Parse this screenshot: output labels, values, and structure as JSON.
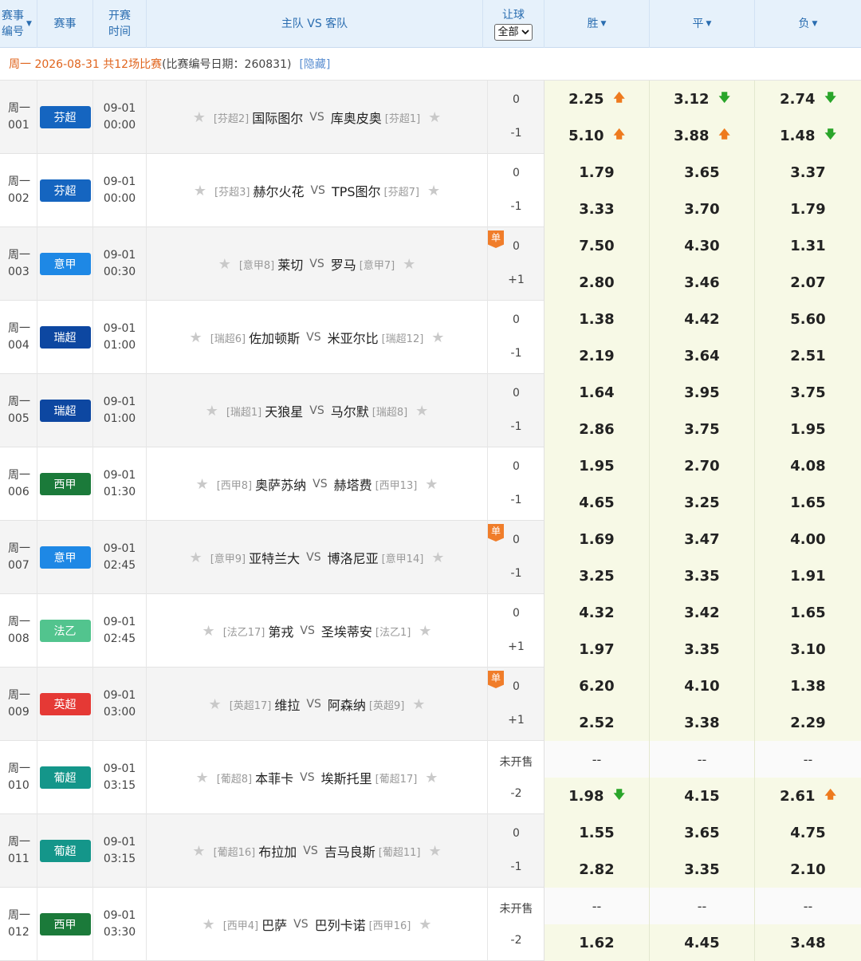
{
  "header": {
    "num_label_line1": "赛事",
    "num_label_line2": "编号",
    "league_label": "赛事",
    "time_label_line1": "开赛",
    "time_label_line2": "时间",
    "teams_label": "主队 VS 客队",
    "handicap_label": "让球",
    "handicap_select": "全部",
    "win_label": "胜",
    "draw_label": "平",
    "lose_label": "负"
  },
  "date_bar": {
    "summary": "周一 2026-08-31 共12场比赛",
    "detail": "(比赛编号日期：260831)",
    "hide_link": "[隐藏]"
  },
  "colors": {
    "finland": "#1565c0",
    "italy": "#1e88e5",
    "swiss": "#0d47a1",
    "spain": "#1b7a3a",
    "ligue2": "#52c48e",
    "epl": "#e53935",
    "portugal": "#14968a",
    "arrow_up": "#ee7a1e",
    "arrow_down": "#2aa52a",
    "dan_badge": "#f07d2a"
  },
  "matches": [
    {
      "day": "周一",
      "num": "001",
      "league": "芬超",
      "color": "#1565c0",
      "date": "09-01",
      "time": "00:00",
      "home_rank": "[芬超2]",
      "home": "国际图尔",
      "vs": "VS",
      "away": "库奥皮奥",
      "away_rank": "[芬超1]",
      "dan": "",
      "hc0": "0",
      "hc1": "-1",
      "odds": [
        [
          {
            "v": "2.25",
            "a": "up"
          },
          {
            "v": "3.12",
            "a": "down"
          },
          {
            "v": "2.74",
            "a": "down"
          }
        ],
        [
          {
            "v": "5.10",
            "a": "up"
          },
          {
            "v": "3.88",
            "a": "up"
          },
          {
            "v": "1.48",
            "a": "down"
          }
        ]
      ]
    },
    {
      "day": "周一",
      "num": "002",
      "league": "芬超",
      "color": "#1565c0",
      "date": "09-01",
      "time": "00:00",
      "home_rank": "[芬超3]",
      "home": "赫尔火花",
      "vs": "VS",
      "away": "TPS图尔",
      "away_rank": "[芬超7]",
      "dan": "",
      "hc0": "0",
      "hc1": "-1",
      "odds": [
        [
          {
            "v": "1.79"
          },
          {
            "v": "3.65"
          },
          {
            "v": "3.37"
          }
        ],
        [
          {
            "v": "3.33"
          },
          {
            "v": "3.70"
          },
          {
            "v": "1.79"
          }
        ]
      ]
    },
    {
      "day": "周一",
      "num": "003",
      "league": "意甲",
      "color": "#1e88e5",
      "date": "09-01",
      "time": "00:30",
      "home_rank": "[意甲8]",
      "home": "莱切",
      "vs": "VS",
      "away": "罗马",
      "away_rank": "[意甲7]",
      "dan": "单",
      "hc0": "0",
      "hc1": "+1",
      "odds": [
        [
          {
            "v": "7.50"
          },
          {
            "v": "4.30"
          },
          {
            "v": "1.31"
          }
        ],
        [
          {
            "v": "2.80"
          },
          {
            "v": "3.46"
          },
          {
            "v": "2.07"
          }
        ]
      ]
    },
    {
      "day": "周一",
      "num": "004",
      "league": "瑞超",
      "color": "#0d47a1",
      "date": "09-01",
      "time": "01:00",
      "home_rank": "[瑞超6]",
      "home": "佐加顿斯",
      "vs": "VS",
      "away": "米亚尔比",
      "away_rank": "[瑞超12]",
      "dan": "",
      "hc0": "0",
      "hc1": "-1",
      "odds": [
        [
          {
            "v": "1.38"
          },
          {
            "v": "4.42"
          },
          {
            "v": "5.60"
          }
        ],
        [
          {
            "v": "2.19"
          },
          {
            "v": "3.64"
          },
          {
            "v": "2.51"
          }
        ]
      ]
    },
    {
      "day": "周一",
      "num": "005",
      "league": "瑞超",
      "color": "#0d47a1",
      "date": "09-01",
      "time": "01:00",
      "home_rank": "[瑞超1]",
      "home": "天狼星",
      "vs": "VS",
      "away": "马尔默",
      "away_rank": "[瑞超8]",
      "dan": "",
      "hc0": "0",
      "hc1": "-1",
      "odds": [
        [
          {
            "v": "1.64"
          },
          {
            "v": "3.95"
          },
          {
            "v": "3.75"
          }
        ],
        [
          {
            "v": "2.86"
          },
          {
            "v": "3.75"
          },
          {
            "v": "1.95"
          }
        ]
      ]
    },
    {
      "day": "周一",
      "num": "006",
      "league": "西甲",
      "color": "#1b7a3a",
      "date": "09-01",
      "time": "01:30",
      "home_rank": "[西甲8]",
      "home": "奥萨苏纳",
      "vs": "VS",
      "away": "赫塔费",
      "away_rank": "[西甲13]",
      "dan": "",
      "hc0": "0",
      "hc1": "-1",
      "odds": [
        [
          {
            "v": "1.95"
          },
          {
            "v": "2.70"
          },
          {
            "v": "4.08"
          }
        ],
        [
          {
            "v": "4.65"
          },
          {
            "v": "3.25"
          },
          {
            "v": "1.65"
          }
        ]
      ]
    },
    {
      "day": "周一",
      "num": "007",
      "league": "意甲",
      "color": "#1e88e5",
      "date": "09-01",
      "time": "02:45",
      "home_rank": "[意甲9]",
      "home": "亚特兰大",
      "vs": "VS",
      "away": "博洛尼亚",
      "away_rank": "[意甲14]",
      "dan": "单",
      "hc0": "0",
      "hc1": "-1",
      "odds": [
        [
          {
            "v": "1.69"
          },
          {
            "v": "3.47"
          },
          {
            "v": "4.00"
          }
        ],
        [
          {
            "v": "3.25"
          },
          {
            "v": "3.35"
          },
          {
            "v": "1.91"
          }
        ]
      ]
    },
    {
      "day": "周一",
      "num": "008",
      "league": "法乙",
      "color": "#52c48e",
      "date": "09-01",
      "time": "02:45",
      "home_rank": "[法乙17]",
      "home": "第戎",
      "vs": "VS",
      "away": "圣埃蒂安",
      "away_rank": "[法乙1]",
      "dan": "",
      "hc0": "0",
      "hc1": "+1",
      "odds": [
        [
          {
            "v": "4.32"
          },
          {
            "v": "3.42"
          },
          {
            "v": "1.65"
          }
        ],
        [
          {
            "v": "1.97"
          },
          {
            "v": "3.35"
          },
          {
            "v": "3.10"
          }
        ]
      ]
    },
    {
      "day": "周一",
      "num": "009",
      "league": "英超",
      "color": "#e53935",
      "date": "09-01",
      "time": "03:00",
      "home_rank": "[英超17]",
      "home": "维拉",
      "vs": "VS",
      "away": "阿森纳",
      "away_rank": "[英超9]",
      "dan": "单",
      "hc0": "0",
      "hc1": "+1",
      "odds": [
        [
          {
            "v": "6.20"
          },
          {
            "v": "4.10"
          },
          {
            "v": "1.38"
          }
        ],
        [
          {
            "v": "2.52"
          },
          {
            "v": "3.38"
          },
          {
            "v": "2.29"
          }
        ]
      ]
    },
    {
      "day": "周一",
      "num": "010",
      "league": "葡超",
      "color": "#14968a",
      "date": "09-01",
      "time": "03:15",
      "home_rank": "[葡超8]",
      "home": "本菲卡",
      "vs": "VS",
      "away": "埃斯托里",
      "away_rank": "[葡超17]",
      "dan": "",
      "hc0": "未开售",
      "hc1": "-2",
      "odds": [
        [
          {
            "v": "--",
            "blank": true
          },
          {
            "v": "--",
            "blank": true
          },
          {
            "v": "--",
            "blank": true
          }
        ],
        [
          {
            "v": "1.98",
            "a": "down"
          },
          {
            "v": "4.15"
          },
          {
            "v": "2.61",
            "a": "up"
          }
        ]
      ]
    },
    {
      "day": "周一",
      "num": "011",
      "league": "葡超",
      "color": "#14968a",
      "date": "09-01",
      "time": "03:15",
      "home_rank": "[葡超16]",
      "home": "布拉加",
      "vs": "VS",
      "away": "吉马良斯",
      "away_rank": "[葡超11]",
      "dan": "",
      "hc0": "0",
      "hc1": "-1",
      "odds": [
        [
          {
            "v": "1.55"
          },
          {
            "v": "3.65"
          },
          {
            "v": "4.75"
          }
        ],
        [
          {
            "v": "2.82"
          },
          {
            "v": "3.35"
          },
          {
            "v": "2.10"
          }
        ]
      ]
    },
    {
      "day": "周一",
      "num": "012",
      "league": "西甲",
      "color": "#1b7a3a",
      "date": "09-01",
      "time": "03:30",
      "home_rank": "[西甲4]",
      "home": "巴萨",
      "vs": "VS",
      "away": "巴列卡诺",
      "away_rank": "[西甲16]",
      "dan": "",
      "hc0": "未开售",
      "hc1": "-2",
      "odds": [
        [
          {
            "v": "--",
            "blank": true
          },
          {
            "v": "--",
            "blank": true
          },
          {
            "v": "--",
            "blank": true
          }
        ],
        [
          {
            "v": "1.62"
          },
          {
            "v": "4.45"
          },
          {
            "v": "3.48"
          }
        ]
      ]
    }
  ]
}
